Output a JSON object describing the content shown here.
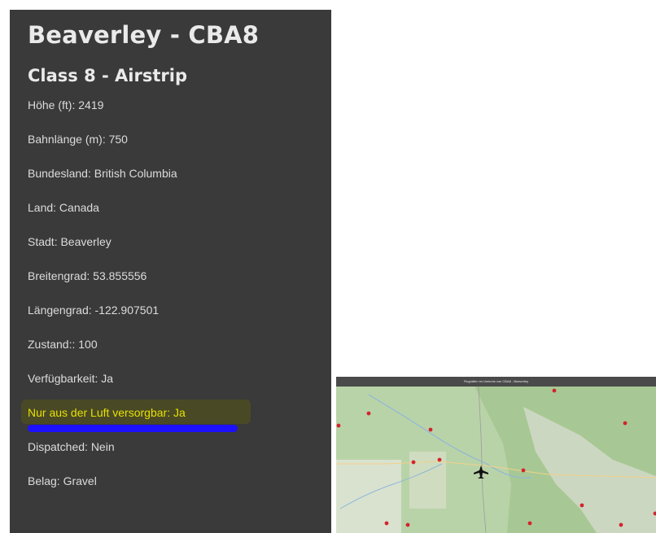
{
  "airport": {
    "title": "Beaverley - CBA8",
    "class": "Class 8 - Airstrip",
    "details": [
      "Höhe (ft): 2419",
      "Bahnlänge (m): 750",
      "Bundesland: British Columbia",
      "Land: Canada",
      "Stadt: Beaverley",
      "Breitengrad: 53.855556",
      "Längengrad: -122.907501",
      "Zustand:: 100",
      "Verfügbarkeit: Ja",
      "Nur aus der Luft versorgbar: Ja",
      "Dispatched: Nein",
      "Belag: Gravel"
    ],
    "highlight_color": "#e6e000",
    "underline_color": "#1d10ff"
  },
  "map": {
    "title_text": "Flughäfen im Umkreis von CBA8 - Beaverley",
    "marker_color": "#d3242c",
    "plane_icon": "airplane-icon"
  }
}
